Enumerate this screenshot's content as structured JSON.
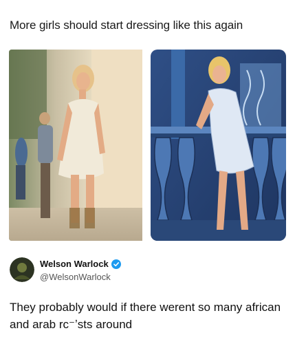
{
  "post": {
    "caption": "More girls should start dressing like this again"
  },
  "images": {
    "left_photo": "photo-woman-white-dress-street",
    "right_illustration": "illustration-woman-white-dress-balcony"
  },
  "tweet": {
    "author_name": "Welson Warlock",
    "author_handle": "@WelsonWarlock",
    "verified_icon": "verified-badge-icon",
    "text": "They probably would if there werent so many african and arab rc⁻ʼsts around"
  },
  "colors": {
    "verified": "#1d9bf0",
    "text": "#111111",
    "handle": "#555555"
  }
}
